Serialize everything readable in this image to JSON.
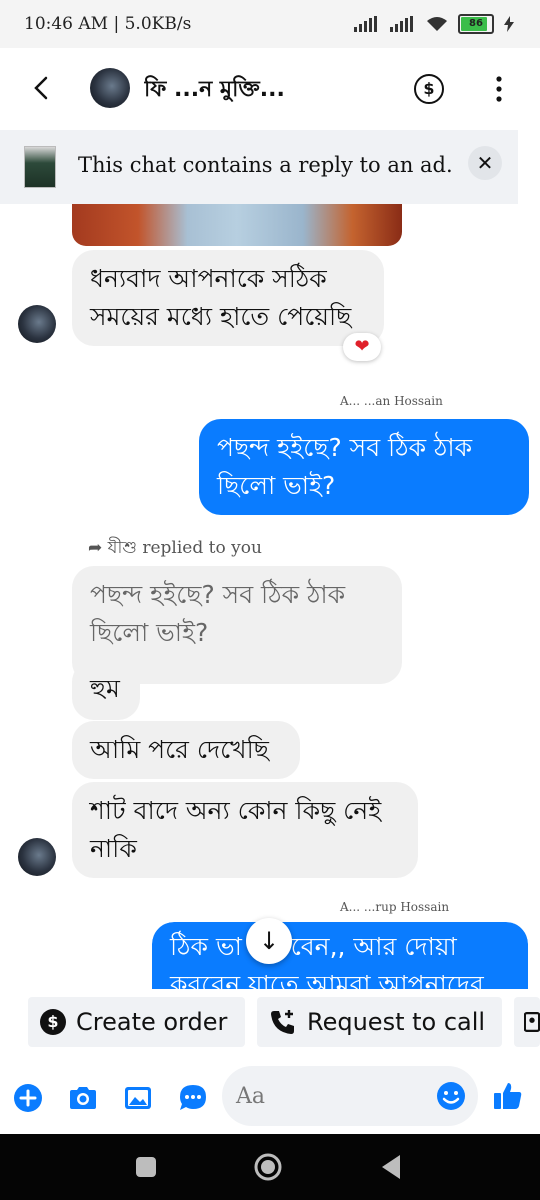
{
  "status_bar": {
    "time": "10:46 AM | 5.0KB/s",
    "battery": "86"
  },
  "header": {
    "contact_name": "ফি ...ন মুক্তি...",
    "dollar_label": "$"
  },
  "ad_banner": {
    "text": "This chat contains a reply to an ad.",
    "close_label": "✕"
  },
  "messages": {
    "m1_text": "ধন্যবাদ আপনাকে সঠিক সময়ের মধ্যে হাতে পেয়েছি",
    "m1_reaction": "❤",
    "sender_label_1": "A... ...an Hossain",
    "m2_text": "পছন্দ হইছে? সব ঠিক ঠাক ছিলো ভাই?",
    "reply_label": "যীশু replied to you",
    "quoted_text": "পছন্দ হইছে? সব ঠিক ঠাক ছিলো ভাই?",
    "m3_text": "হুম",
    "m4_text": "আমি পরে দেখেছি",
    "m5_text": "শাট বাদে অন্য কোন কিছু নেই নাকি",
    "sender_label_2": "A... ...rup Hossain",
    "m6_text": "ঠিক ভা থাকবেন,, আর দোয়া করবেন যাতে আমরা আপনাদের"
  },
  "quick_actions": {
    "create_order": "Create order",
    "request_call": "Request to call"
  },
  "composer": {
    "placeholder": "Aa"
  },
  "colors": {
    "accent": "#0a7cff",
    "incoming_bubble": "#f0f0f0",
    "banner_bg": "#f0f2f5"
  }
}
